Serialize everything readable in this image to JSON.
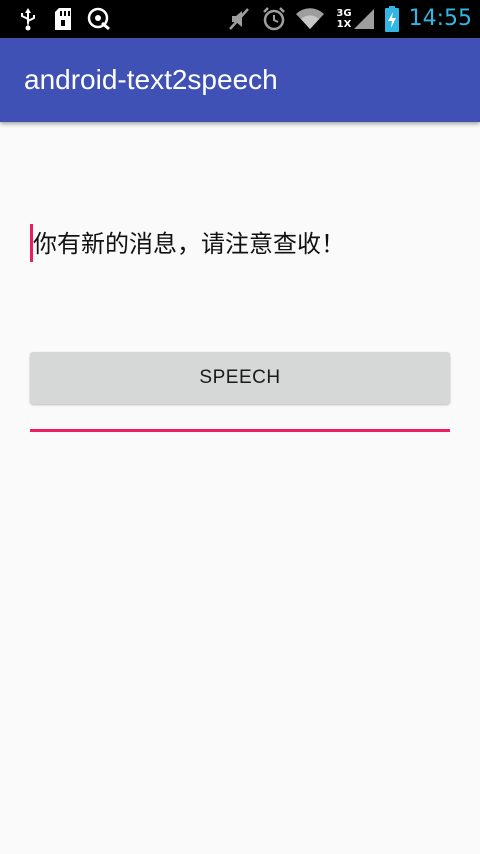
{
  "status_bar": {
    "time": "14:55",
    "network_label": "3G",
    "network_sub_label": "1X",
    "left_icons": [
      "usb-icon",
      "sd-card-icon",
      "dictionary-icon"
    ],
    "right_icons": [
      "mute-icon",
      "alarm-icon",
      "wifi-icon",
      "signal-icon",
      "battery-charging-icon"
    ],
    "time_color": "#33b5e5"
  },
  "app_bar": {
    "title": "android-text2speech",
    "color": "#3f51b5"
  },
  "editor": {
    "value": "你有新的消息，请注意查收！",
    "accent_color": "#e91e63"
  },
  "button": {
    "label": "SPEECH"
  }
}
